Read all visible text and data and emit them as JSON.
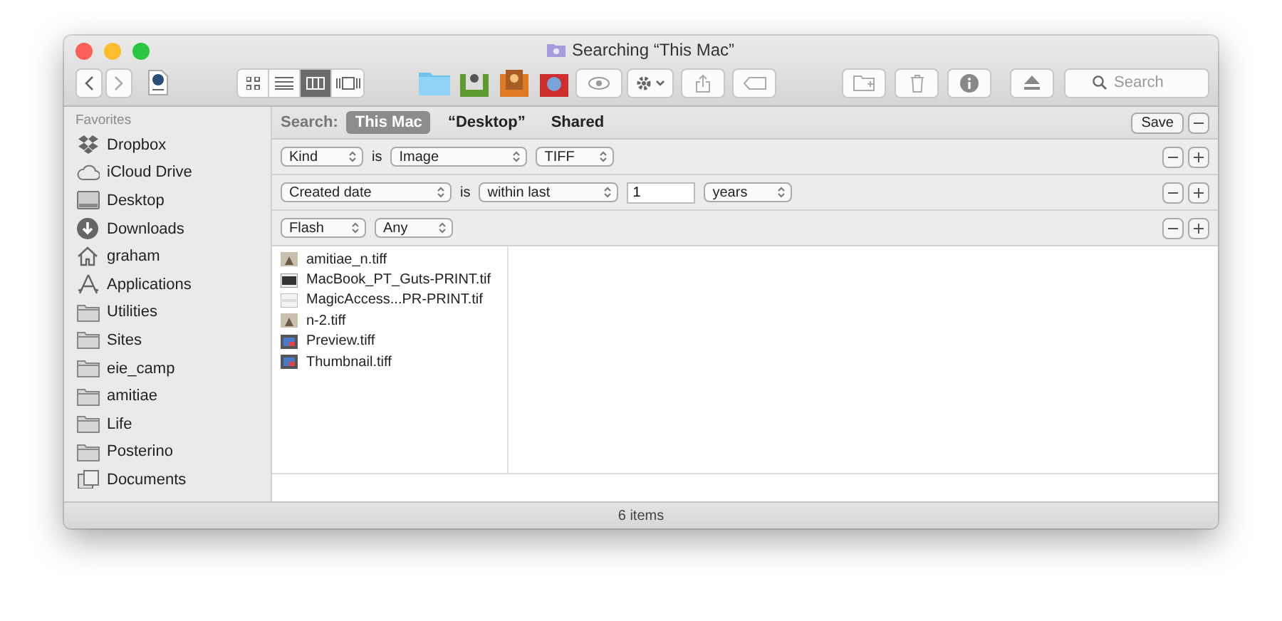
{
  "window": {
    "title": "Searching “This Mac”"
  },
  "toolbar": {
    "view_modes": [
      {
        "kind": "icons",
        "selected": false
      },
      {
        "kind": "list",
        "selected": false
      },
      {
        "kind": "columns",
        "selected": true
      },
      {
        "kind": "cover",
        "selected": false
      }
    ],
    "search": {
      "placeholder": "Search"
    }
  },
  "sidebar": {
    "heading": "Favorites",
    "items": [
      {
        "label": "Dropbox",
        "kind": "dropbox"
      },
      {
        "label": "iCloud Drive",
        "kind": "cloud"
      },
      {
        "label": "Desktop",
        "kind": "desktop"
      },
      {
        "label": "Downloads",
        "kind": "download"
      },
      {
        "label": "graham",
        "kind": "home"
      },
      {
        "label": "Applications",
        "kind": "apps"
      },
      {
        "label": "Utilities",
        "kind": "folder"
      },
      {
        "label": "Sites",
        "kind": "folder"
      },
      {
        "label": "eie_camp",
        "kind": "folder"
      },
      {
        "label": "amitiae",
        "kind": "folder"
      },
      {
        "label": "Life",
        "kind": "folder"
      },
      {
        "label": "Posterino",
        "kind": "folder"
      },
      {
        "label": "Documents",
        "kind": "documents"
      }
    ]
  },
  "search_bar": {
    "label": "Search:",
    "scopes": [
      {
        "label": "This Mac",
        "selected": true
      },
      {
        "label": "“Desktop”",
        "selected": false
      },
      {
        "label": "Shared",
        "selected": false
      }
    ],
    "save": "Save"
  },
  "criteria": [
    {
      "parts": [
        {
          "kind": "popup",
          "text": "Kind"
        },
        {
          "kind": "text",
          "text": "is"
        },
        {
          "kind": "popup",
          "text": "Image"
        },
        {
          "kind": "popup",
          "text": "TIFF"
        }
      ]
    },
    {
      "parts": [
        {
          "kind": "popup",
          "text": "Created date"
        },
        {
          "kind": "text",
          "text": "is"
        },
        {
          "kind": "popup",
          "text": "within last"
        },
        {
          "kind": "field",
          "text": "1"
        },
        {
          "kind": "popup",
          "text": "years"
        }
      ]
    },
    {
      "parts": [
        {
          "kind": "popup",
          "text": "Flash"
        },
        {
          "kind": "popup",
          "text": "Any"
        }
      ]
    }
  ],
  "files": [
    {
      "name": "amitiae_n.tiff",
      "kind": "photo"
    },
    {
      "name": "MacBook_PT_Guts-PRINT.tif",
      "kind": "dark"
    },
    {
      "name": "MagicAccess...PR-PRINT.tif",
      "kind": "blank"
    },
    {
      "name": "n-2.tiff",
      "kind": "photo"
    },
    {
      "name": "Preview.tiff",
      "kind": "screen"
    },
    {
      "name": "Thumbnail.tiff",
      "kind": "screen"
    }
  ],
  "status_bar": "6 items"
}
